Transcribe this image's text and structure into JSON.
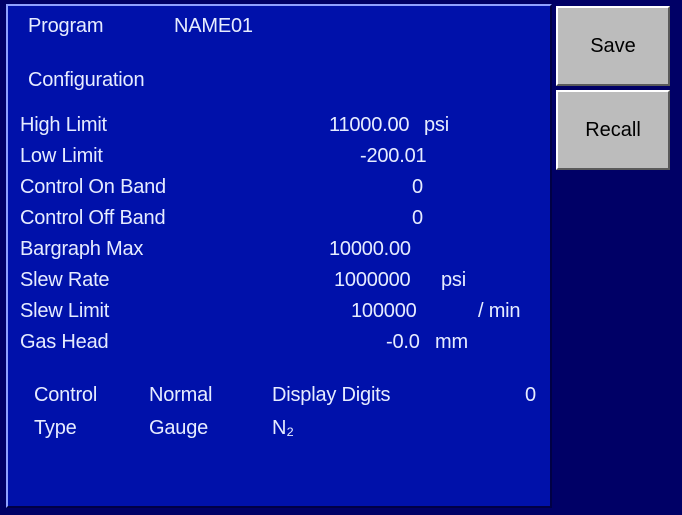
{
  "header": {
    "program_label": "Program",
    "program_name": "NAME01",
    "section_title": "Configuration"
  },
  "settings": [
    {
      "label": "High Limit",
      "value": "11000.00",
      "unit": "psi",
      "extra": ""
    },
    {
      "label": "Low Limit",
      "value": "-200.01",
      "unit": "",
      "extra": ""
    },
    {
      "label": "Control On Band",
      "value": "0",
      "unit": "",
      "extra": ""
    },
    {
      "label": "Control Off Band",
      "value": "0",
      "unit": "",
      "extra": ""
    },
    {
      "label": "Bargraph Max",
      "value": "10000.00",
      "unit": "",
      "extra": ""
    },
    {
      "label": "Slew Rate",
      "value": "1000000",
      "unit": "psi",
      "extra": ""
    },
    {
      "label": "Slew Limit",
      "value": "100000",
      "unit": "",
      "extra": "/ min"
    },
    {
      "label": "Gas Head",
      "value": "-0.0",
      "unit": "mm",
      "extra": ""
    }
  ],
  "footer": {
    "control_label": "Control",
    "control_value": "Normal",
    "display_digits_label": "Display Digits",
    "display_digits_value": "0",
    "type_label": "Type",
    "type_value": "Gauge",
    "gas_value": "N₂"
  },
  "buttons": {
    "save": "Save",
    "recall": "Recall"
  },
  "colors": {
    "panel_bg": "#0011AA",
    "screen_bg": "#000066",
    "text": "#E6ECFF",
    "button_bg": "#BCBCBC"
  }
}
